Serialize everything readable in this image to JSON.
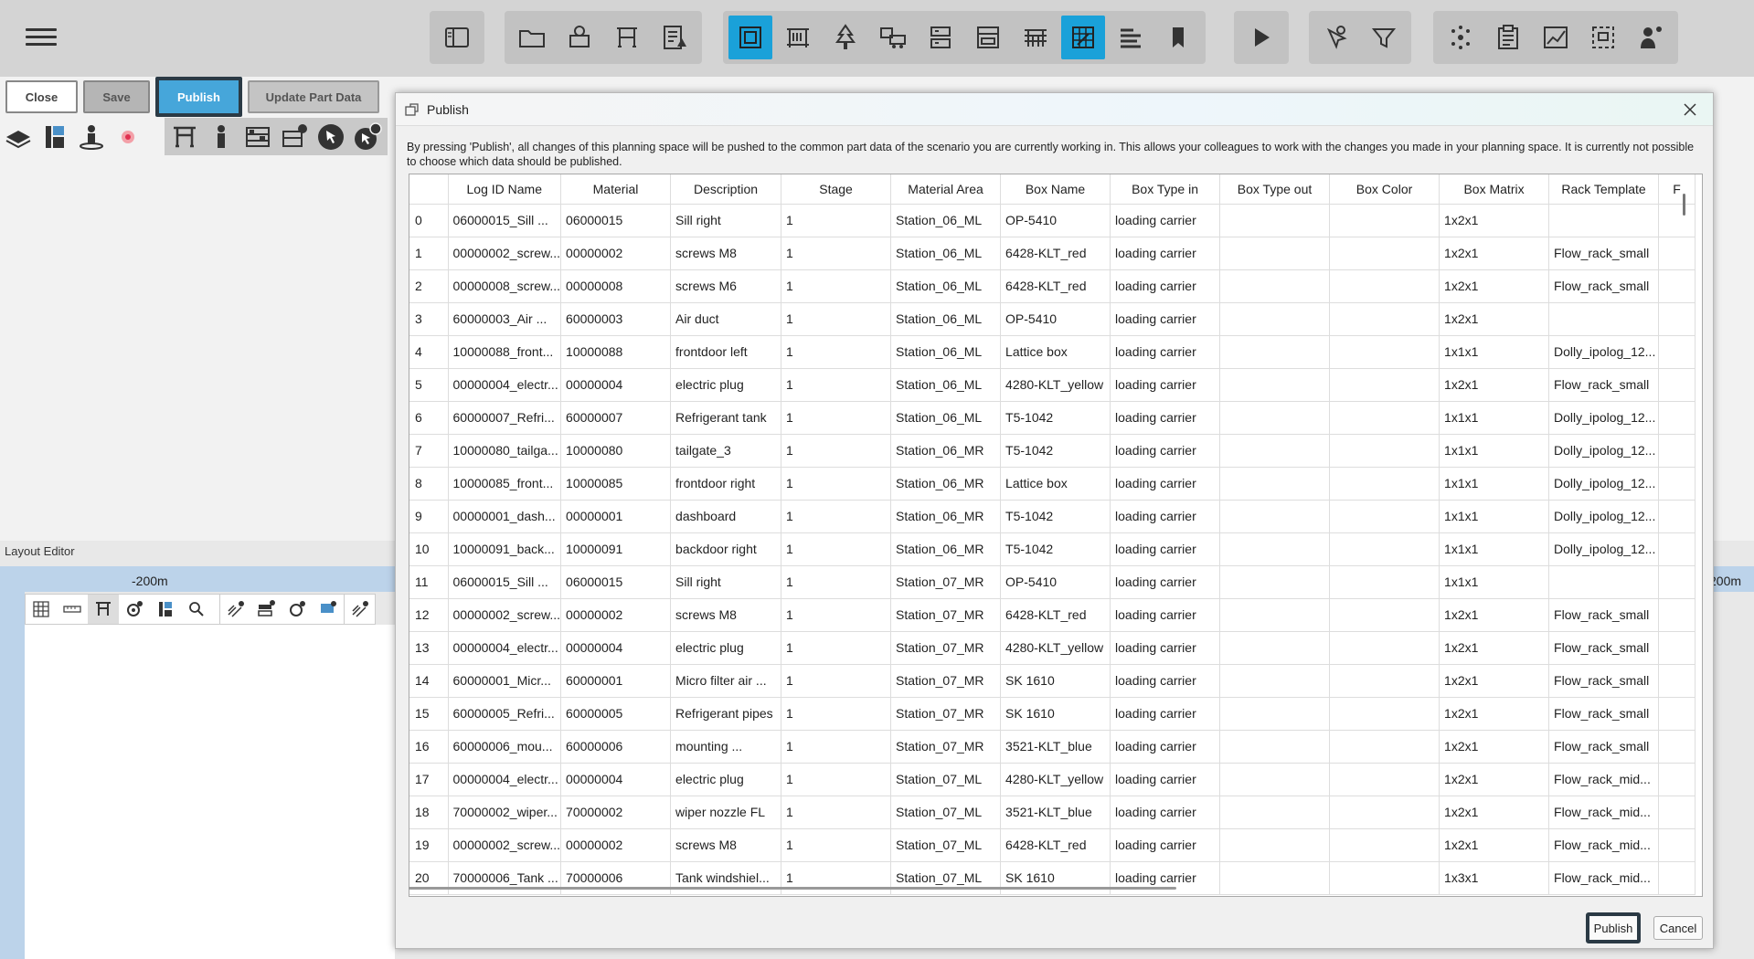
{
  "toolbar": {
    "menu_icon": "hamburger-icon",
    "groups": [
      [
        "sidebar-panel-icon"
      ],
      [
        "folder-icon",
        "parts-icon",
        "rack-icon",
        "report-icon"
      ],
      [
        "layout-frame-icon",
        "shelf-icon",
        "tree-icon",
        "vehicles-icon",
        "storage-icon",
        "cabinet-icon",
        "assembly-icon",
        "area-grid-icon",
        "list-align-icon",
        "bookmark-icon"
      ],
      [
        "play-icon"
      ],
      [
        "cursor-settings-icon",
        "filter-icon"
      ],
      [
        "network-icon",
        "clipboard-icon",
        "chart-icon",
        "screenshot-icon",
        "person-info-icon"
      ]
    ],
    "active_icons": [
      "layout-frame-icon",
      "area-grid-icon"
    ]
  },
  "actions": {
    "close": "Close",
    "save": "Save",
    "publish": "Publish",
    "update": "Update Part Data"
  },
  "layout_editor": {
    "title": "Layout Editor",
    "ruler_left": "-200m",
    "ruler_right": "200m"
  },
  "dialog": {
    "title": "Publish",
    "description": "By pressing 'Publish', all changes of this planning space will be pushed to the common part data of the scenario you are currently working in. This allows your colleagues to work with the changes you made in your planning space. It is currently not possible to choose which data should be published.",
    "columns": [
      "",
      "Log ID Name",
      "Material",
      "Description",
      "Stage",
      "Material Area",
      "Box Name",
      "Box Type in",
      "Box Type out",
      "Box Color",
      "Box Matrix",
      "Rack Template",
      "F"
    ],
    "rows": [
      [
        "0",
        "06000015_Sill ...",
        "06000015",
        "Sill right",
        "1",
        "Station_06_ML",
        "OP-5410",
        "loading carrier",
        "",
        "",
        "1x2x1",
        ""
      ],
      [
        "1",
        "00000002_screw...",
        "00000002",
        "screws M8",
        "1",
        "Station_06_ML",
        "6428-KLT_red",
        "loading carrier",
        "",
        "",
        "1x2x1",
        "Flow_rack_small"
      ],
      [
        "2",
        "00000008_screw...",
        "00000008",
        "screws M6",
        "1",
        "Station_06_ML",
        "6428-KLT_red",
        "loading carrier",
        "",
        "",
        "1x2x1",
        "Flow_rack_small"
      ],
      [
        "3",
        "60000003_Air ...",
        "60000003",
        "Air duct",
        "1",
        "Station_06_ML",
        "OP-5410",
        "loading carrier",
        "",
        "",
        "1x2x1",
        ""
      ],
      [
        "4",
        "10000088_front...",
        "10000088",
        "frontdoor left",
        "1",
        "Station_06_ML",
        "Lattice box",
        "loading carrier",
        "",
        "",
        "1x1x1",
        "Dolly_ipolog_12..."
      ],
      [
        "5",
        "00000004_electr...",
        "00000004",
        "electric plug",
        "1",
        "Station_06_ML",
        "4280-KLT_yellow",
        "loading carrier",
        "",
        "",
        "1x2x1",
        "Flow_rack_small"
      ],
      [
        "6",
        "60000007_Refri...",
        "60000007",
        "Refrigerant tank",
        "1",
        "Station_06_ML",
        "T5-1042",
        "loading carrier",
        "",
        "",
        "1x1x1",
        "Dolly_ipolog_12..."
      ],
      [
        "7",
        "10000080_tailga...",
        "10000080",
        "tailgate_3",
        "1",
        "Station_06_MR",
        "T5-1042",
        "loading carrier",
        "",
        "",
        "1x1x1",
        "Dolly_ipolog_12..."
      ],
      [
        "8",
        "10000085_front...",
        "10000085",
        "frontdoor right",
        "1",
        "Station_06_MR",
        "Lattice box",
        "loading carrier",
        "",
        "",
        "1x1x1",
        "Dolly_ipolog_12..."
      ],
      [
        "9",
        "00000001_dash...",
        "00000001",
        "dashboard",
        "1",
        "Station_06_MR",
        "T5-1042",
        "loading carrier",
        "",
        "",
        "1x1x1",
        "Dolly_ipolog_12..."
      ],
      [
        "10",
        "10000091_back...",
        "10000091",
        "backdoor right",
        "1",
        "Station_06_MR",
        "T5-1042",
        "loading carrier",
        "",
        "",
        "1x1x1",
        "Dolly_ipolog_12..."
      ],
      [
        "11",
        "06000015_Sill ...",
        "06000015",
        "Sill right",
        "1",
        "Station_07_MR",
        "OP-5410",
        "loading carrier",
        "",
        "",
        "1x1x1",
        ""
      ],
      [
        "12",
        "00000002_screw...",
        "00000002",
        "screws M8",
        "1",
        "Station_07_MR",
        "6428-KLT_red",
        "loading carrier",
        "",
        "",
        "1x2x1",
        "Flow_rack_small"
      ],
      [
        "13",
        "00000004_electr...",
        "00000004",
        "electric plug",
        "1",
        "Station_07_MR",
        "4280-KLT_yellow",
        "loading carrier",
        "",
        "",
        "1x2x1",
        "Flow_rack_small"
      ],
      [
        "14",
        "60000001_Micr...",
        "60000001",
        "Micro filter air ...",
        "1",
        "Station_07_MR",
        "SK 1610",
        "loading carrier",
        "",
        "",
        "1x2x1",
        "Flow_rack_small"
      ],
      [
        "15",
        "60000005_Refri...",
        "60000005",
        "Refrigerant pipes",
        "1",
        "Station_07_MR",
        "SK 1610",
        "loading carrier",
        "",
        "",
        "1x2x1",
        "Flow_rack_small"
      ],
      [
        "16",
        "60000006_mou...",
        "60000006",
        "mounting ...",
        "1",
        "Station_07_MR",
        "3521-KLT_blue",
        "loading carrier",
        "",
        "",
        "1x2x1",
        "Flow_rack_small"
      ],
      [
        "17",
        "00000004_electr...",
        "00000004",
        "electric plug",
        "1",
        "Station_07_ML",
        "4280-KLT_yellow",
        "loading carrier",
        "",
        "",
        "1x2x1",
        "Flow_rack_mid..."
      ],
      [
        "18",
        "70000002_wiper...",
        "70000002",
        "wiper nozzle FL",
        "1",
        "Station_07_ML",
        "3521-KLT_blue",
        "loading carrier",
        "",
        "",
        "1x2x1",
        "Flow_rack_mid..."
      ],
      [
        "19",
        "00000002_screw...",
        "00000002",
        "screws M8",
        "1",
        "Station_07_ML",
        "6428-KLT_red",
        "loading carrier",
        "",
        "",
        "1x2x1",
        "Flow_rack_mid..."
      ],
      [
        "20",
        "70000006_Tank ...",
        "70000006",
        "Tank windshiel...",
        "1",
        "Station_07_ML",
        "SK 1610",
        "loading carrier",
        "",
        "",
        "1x3x1",
        "Flow_rack_mid..."
      ]
    ],
    "publish_button": "Publish",
    "cancel_button": "Cancel"
  }
}
